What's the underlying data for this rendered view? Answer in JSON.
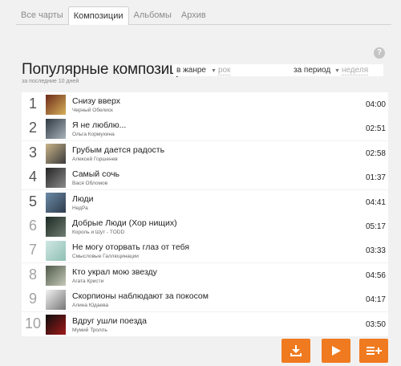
{
  "tabs": [
    {
      "label": "Все чарты"
    },
    {
      "label": "Композиции"
    },
    {
      "label": "Альбомы"
    },
    {
      "label": "Архив"
    }
  ],
  "active_tab": "Композиции",
  "help_glyph": "?",
  "header": {
    "title": "Популярные композиции",
    "subtitle": "за последние 10 дней"
  },
  "filters": {
    "genre_label": "в жанре",
    "genre_value": "рок",
    "period_label": "за период",
    "period_value": "неделя"
  },
  "tracks": [
    {
      "rank": "1",
      "title": "Снизу вверх",
      "artist": "Черный Обелиск",
      "duration": "04:00",
      "cover_colors": [
        "#6e2a1a",
        "#d6b15a"
      ]
    },
    {
      "rank": "2",
      "title": "Я не люблю...",
      "artist": "Ольга Кормухина",
      "duration": "02:51",
      "cover_colors": [
        "#2f3a44",
        "#a9b3ba"
      ]
    },
    {
      "rank": "3",
      "title": "Грубым дается радость",
      "artist": "Алексей Горшенев",
      "duration": "02:58",
      "cover_colors": [
        "#c8b488",
        "#3a3a3a"
      ]
    },
    {
      "rank": "4",
      "title": "Самый сочь",
      "artist": "Вася Обломов",
      "duration": "01:37",
      "cover_colors": [
        "#252525",
        "#8a8a8a"
      ]
    },
    {
      "rank": "5",
      "title": "Люди",
      "artist": "НедРа",
      "duration": "04:41",
      "cover_colors": [
        "#6c8aa6",
        "#2e3d4d"
      ]
    },
    {
      "rank": "6",
      "title": "Добрые Люди (Хор нищих)",
      "artist": "Король и Шут - TODD",
      "duration": "05:17",
      "cover_colors": [
        "#1c2a24",
        "#6f7d72"
      ]
    },
    {
      "rank": "7",
      "title": "Не могу оторвать глаз от тебя",
      "artist": "Смысловые Галлюцинации",
      "duration": "03:33",
      "cover_colors": [
        "#cfe8e2",
        "#8fbfb4"
      ]
    },
    {
      "rank": "8",
      "title": "Кто украл мою звезду",
      "artist": "Агата Кристи",
      "duration": "04:56",
      "cover_colors": [
        "#4f5a4a",
        "#c5c9b8"
      ]
    },
    {
      "rank": "9",
      "title": "Скорпионы наблюдают за покосом",
      "artist": "Алина Юдаева",
      "duration": "04:17",
      "cover_colors": [
        "#f2f2f2",
        "#777777"
      ]
    },
    {
      "rank": "10",
      "title": "Вдруг ушли поезда",
      "artist": "Мумий Тролль",
      "duration": "03:50",
      "cover_colors": [
        "#0d0d0d",
        "#a11a1a"
      ]
    }
  ],
  "actions": [
    {
      "icon": "download-icon"
    },
    {
      "icon": "play-icon"
    },
    {
      "icon": "add-to-playlist-icon"
    }
  ],
  "colors": {
    "accent": "#f07a1f",
    "background": "#f1f1f1"
  }
}
